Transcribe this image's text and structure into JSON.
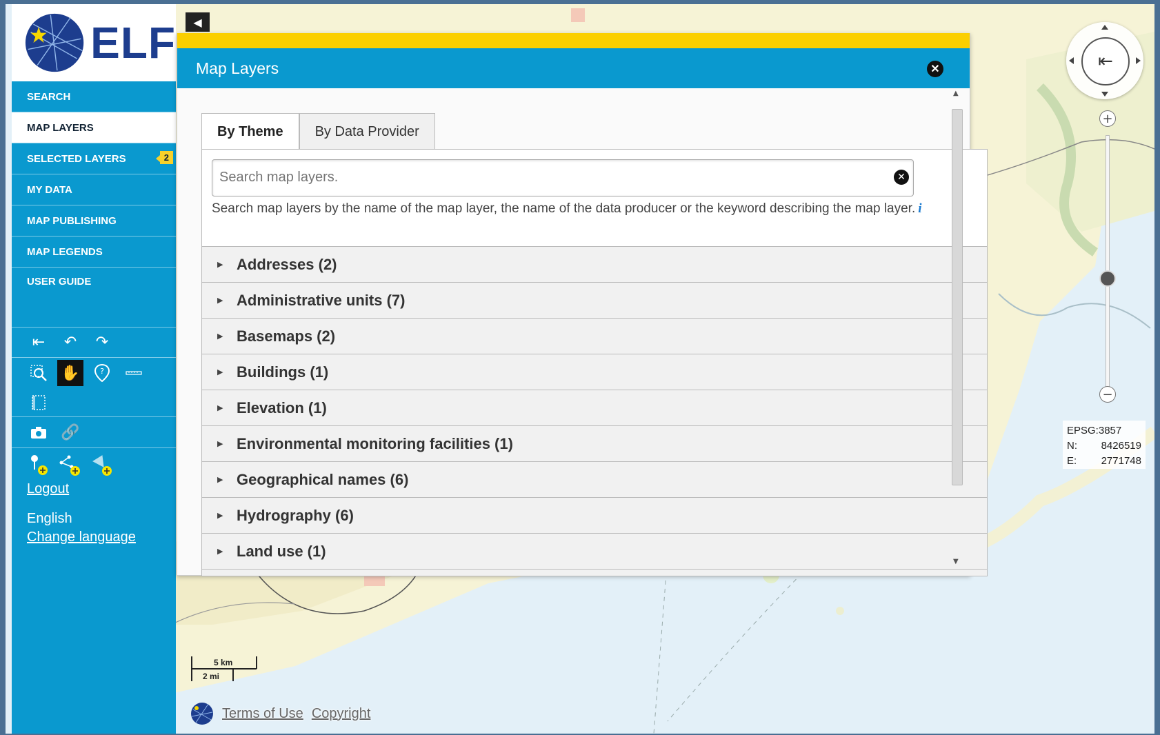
{
  "app": {
    "logo_text": "ELF"
  },
  "sidebar": {
    "items": [
      {
        "label": "SEARCH"
      },
      {
        "label": "MAP LAYERS",
        "active": true
      },
      {
        "label": "SELECTED LAYERS",
        "badge": "2"
      },
      {
        "label": "MY DATA"
      },
      {
        "label": "MAP PUBLISHING"
      },
      {
        "label": "MAP LEGENDS"
      },
      {
        "label": "USER GUIDE"
      }
    ],
    "logout": "Logout",
    "language": "English",
    "change_language": "Change language"
  },
  "panel": {
    "title": "Map Layers",
    "tabs": [
      {
        "label": "By Theme"
      },
      {
        "label": "By Data Provider"
      }
    ],
    "search_placeholder": "Search map layers.",
    "help_text": "Search map layers by the name of the map layer, the name of the data producer or the keyword describing the map layer.",
    "groups": [
      {
        "label": "Addresses (2)"
      },
      {
        "label": "Administrative units (7)"
      },
      {
        "label": "Basemaps (2)"
      },
      {
        "label": "Buildings (1)"
      },
      {
        "label": "Elevation (1)"
      },
      {
        "label": "Environmental monitoring facilities (1)"
      },
      {
        "label": "Geographical names (6)"
      },
      {
        "label": "Hydrography (6)"
      },
      {
        "label": "Land use (1)"
      }
    ]
  },
  "map": {
    "coords": {
      "projection": "EPSG:3857",
      "n_label": "N:",
      "n_value": "8426519",
      "e_label": "E:",
      "e_value": "2771748"
    },
    "scale": {
      "metric": "5 km",
      "imperial": "2 mi"
    },
    "footer": {
      "terms": "Terms of Use",
      "copyright": "Copyright"
    }
  },
  "colors": {
    "primary": "#0a99cf",
    "accent": "#fbcf00",
    "badge": "#f8d12a"
  }
}
